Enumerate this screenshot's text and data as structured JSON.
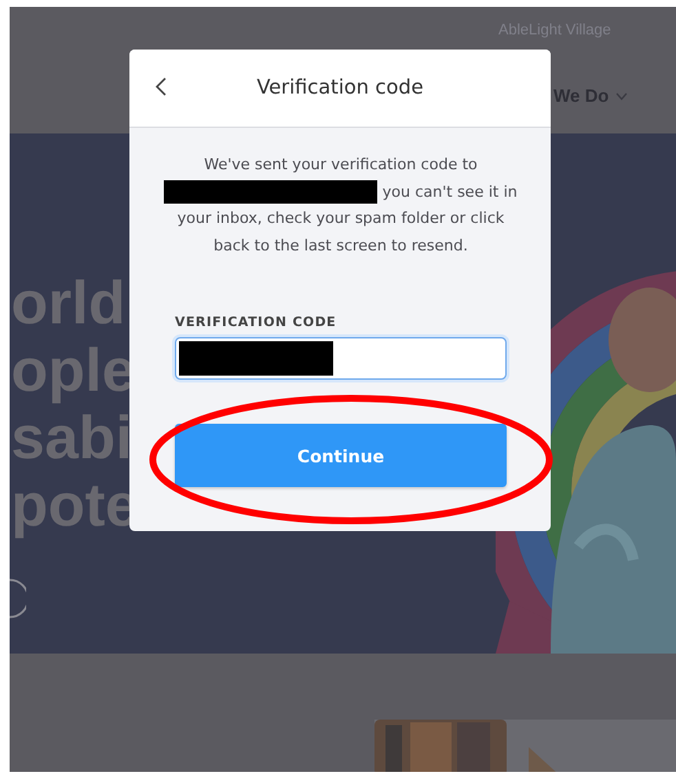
{
  "site_header": {
    "brand_link": "AbleLight Village",
    "nav_item": {
      "label": "We Do",
      "expanded": false
    }
  },
  "hero": {
    "heading_lines": [
      "orld",
      "ople",
      "sabi",
      "pote"
    ]
  },
  "dialog": {
    "title": "Verification code",
    "message_start": "We've sent your verification code to",
    "message_redacted": true,
    "message_end": "you can't see it in your inbox, check your spam folder or click back to the last screen to resend.",
    "field": {
      "label": "VERIFICATION CODE",
      "focused": true,
      "value_redacted": true
    },
    "button": "Continue"
  },
  "highlight": {
    "color": "#ff0000"
  }
}
